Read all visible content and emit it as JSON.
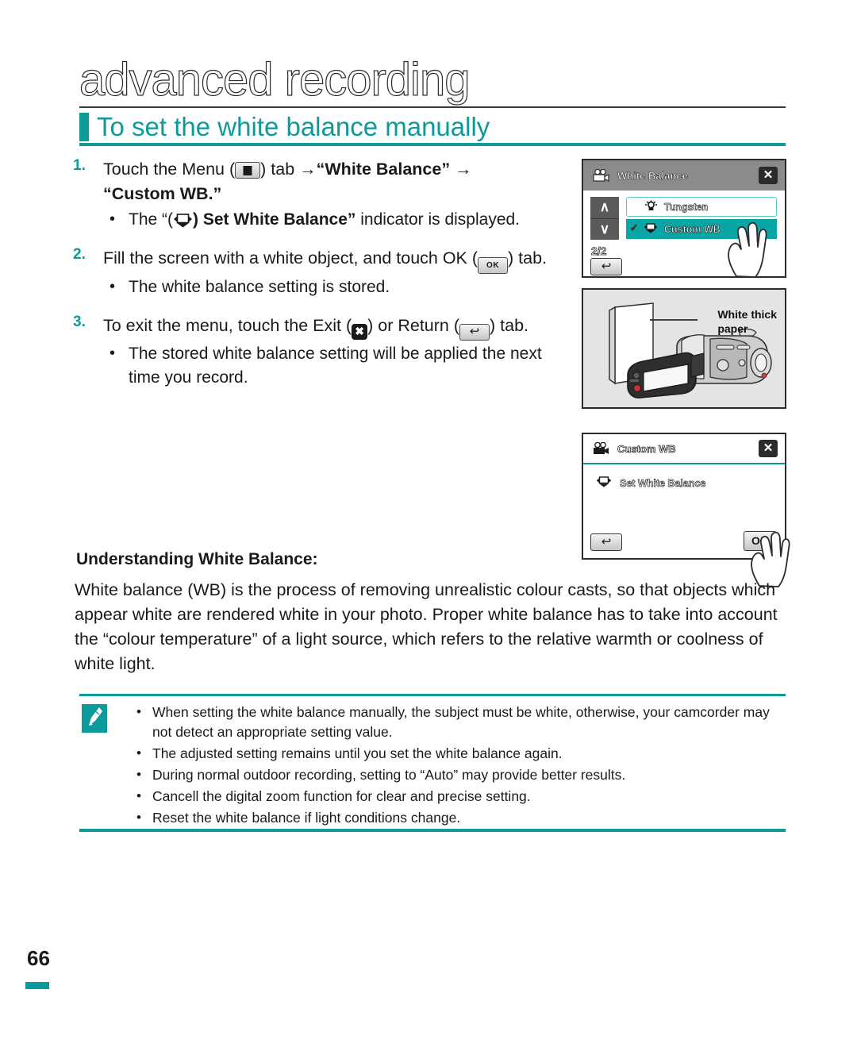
{
  "header": {
    "chapter_title": "advanced recording",
    "section_title": "To set the white balance manually"
  },
  "steps": [
    {
      "number": "1.",
      "text_parts": [
        "Touch the Menu (",
        ") tab → “White Balance” → “Custom WB.”"
      ],
      "icon": "menu-icon",
      "bullets": [
        {
          "text": "The “( ) Set White Balance” indicator is displayed.",
          "icon": "set-white-balance-icon"
        }
      ]
    },
    {
      "number": "2.",
      "text_parts": [
        "Fill the screen with a white object, and touch OK (",
        ") tab."
      ],
      "icon": "ok-icon",
      "bullets": [
        {
          "text": "The white balance setting is stored.",
          "icon": ""
        }
      ]
    },
    {
      "number": "3.",
      "text_parts": [
        "To exit the menu, touch the Exit (",
        ") or Return (",
        ") tab."
      ],
      "icon": "exit-icon",
      "bullets": [
        {
          "text": "The stored white balance setting will be applied the next time you record.",
          "icon": ""
        }
      ]
    }
  ],
  "step_labels": {
    "s1_a": "Touch the Menu (",
    "s1_b": ") tab",
    "s1_arrow1": "→",
    "s1_wb": "“White Balance”",
    "s1_arrow2": "→",
    "s1_custom": "“Custom WB.”",
    "s1_bullet_a": "The “(",
    "s1_bullet_b": ") Set White Balance”",
    "s1_bullet_c": "indicator is displayed.",
    "s2_a": "Fill the screen with a white object, and touch OK (",
    "s2_b": ") tab.",
    "s2_bullet": "The white balance setting is stored.",
    "s3_a": "To exit the menu, touch the Exit (",
    "s3_b": ") or Return (",
    "s3_c": ") tab.",
    "s3_bullet": "The stored white balance setting will be applied the next time you record."
  },
  "figure_menu_screen": {
    "name": "white-balance-menu",
    "title": "White Balance",
    "close_label": "✕",
    "up_label": "∧",
    "down_label": "∨",
    "options": [
      {
        "label": "Tungsten",
        "selected": false,
        "icon": "tungsten-icon"
      },
      {
        "label": "Custom WB",
        "selected": true,
        "icon": "custom-wb-icon",
        "check": "✓"
      }
    ],
    "pager": "2/2",
    "return_label": "↩"
  },
  "figure_camcorder": {
    "name": "camcorder-illustration",
    "label": "White thick\npaper",
    "label_line1": "White thick",
    "label_line2": "paper"
  },
  "figure_custom_wb_screen": {
    "name": "custom-wb-screen",
    "title": "Custom WB",
    "close_label": "✕",
    "row_label": "Set White Balance",
    "return_label": "↩",
    "ok_label": "OK"
  },
  "understanding": {
    "heading": "Understanding White Balance:",
    "body": "White balance (WB) is the process of removing unrealistic colour casts, so that objects which appear white are rendered white in your photo. Proper white balance has to take into account the “colour temperature” of a light source, which refers to the relative warmth or coolness of white light."
  },
  "note": {
    "icon": "note-pen-icon",
    "items": [
      "When setting the white balance manually, the subject must be white, otherwise, your camcorder may not detect an appropriate setting value.",
      "The adjusted setting remains until you set the white balance again.",
      "During normal outdoor recording, setting to “Auto” may provide better results.",
      "Cancell the digital zoom function for clear and precise setting.",
      "Reset the white balance if light conditions change."
    ]
  },
  "footer": {
    "page_number": "66"
  },
  "colors": {
    "accent_teal": "#0d9a9a",
    "lcd_header_gray": "#8b8b8b",
    "selected_teal": "#0aa5a5"
  }
}
